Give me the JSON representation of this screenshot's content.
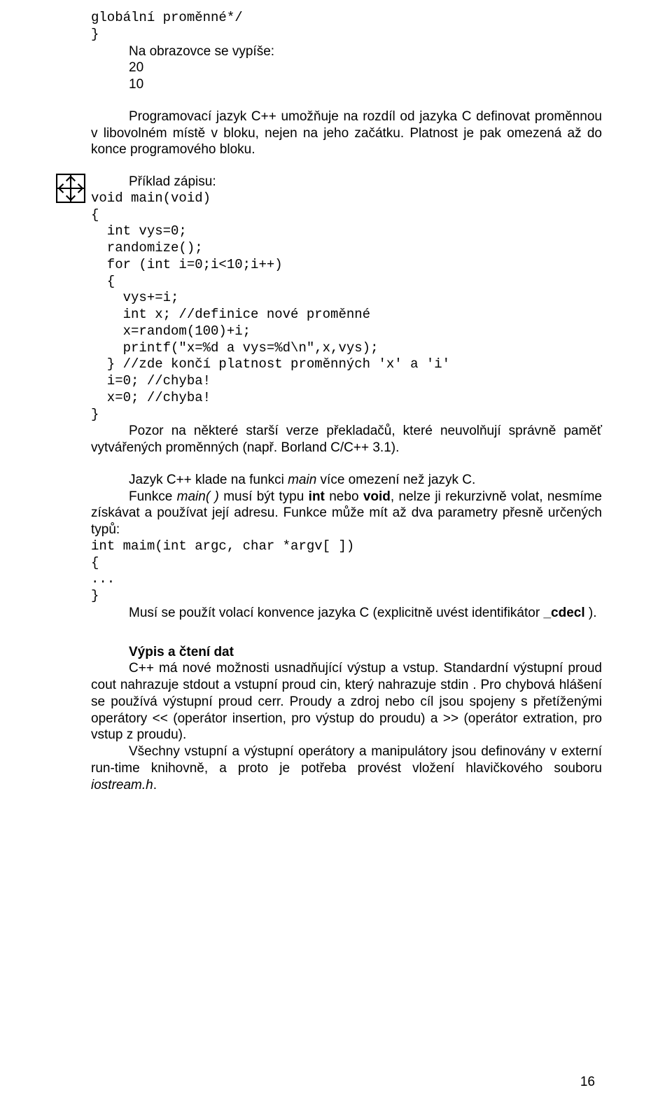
{
  "code_top_1": "globální proměnné*/",
  "code_top_2": "}",
  "out_label": "Na obrazovce se vypíše:",
  "out_1": "20",
  "out_2": "10",
  "para1_a": "Programovací  jazyk C++  umožňuje  na  rozdíl  od  jazyka  C definovat  proměnnou  v libovolném  místě v bloku,  nejen  na  jeho začátku. Platnost je pak omezená až do konce programového bloku.",
  "example": {
    "label": "Příklad zápisu:",
    "l1": "void main(void)",
    "l2": "{",
    "l3": "  int vys=0;",
    "l4": "  randomize();",
    "l5": "  for (int i=0;i<10;i++)",
    "l6": "  {",
    "l7": "    vys+=i;",
    "l8": "    int x; //definice nové proměnné",
    "l9": "    x=random(100)+i;",
    "l10": "    printf(\"x=%d a vys=%d\\n\",x,vys);",
    "l11": "  } //zde končí platnost proměnných 'x' a 'i'",
    "l12": "  i=0; //chyba!",
    "l13": "  x=0; //chyba!",
    "l14": "}"
  },
  "para2": "Pozor  na  některé  starší  verze  překladačů,  které  neuvolňují správně paměť vytvářených proměnných (např. Borland C/C++ 3.1).",
  "para3_a": "Jazyk C++ klade na funkci ",
  "para3_b": "main",
  "para3_c": " více omezení než jazyk C.",
  "para4_a": "Funkce ",
  "para4_b": "main( )",
  "para4_c": " musí být typu ",
  "para4_d": "int",
  "para4_e": " nebo ",
  "para4_f": "void",
  "para4_g": ", nelze ji rekurzivně volat, nesmíme získávat a používat její adresu. Funkce  může  mít až dva parametry přesně určených typů:",
  "proto_1": "int maim(int argc, char *argv[ ])",
  "proto_2": "{",
  "proto_3": "...",
  "proto_4": "}",
  "para5_a": "Musí  se  použít  volací  konvence  jazyka  C  (explicitně  uvést identifikátor ",
  "para5_b": "_cdecl",
  "para5_c": " ).",
  "section_heading": "Výpis a čtení dat",
  "para6_a": "C++ má nové možnosti usnadňující výstup a vstup. Standardní výstupní  proud  cout    nahrazuje  stdout  a  vstupní  proud  cin,  který nahrazuje stdin . Pro chybová hlášení se používá výstupní proud cerr. Proudy  a  zdroj  nebo  cíl  jsou  spojeny  s přetíženými  operátory  << (operátor insertion, pro výstup do proudu) a >> (operátor extration, pro vstup z proudu).",
  "para7_a": "Všechny  vstupní  a  výstupní  operátory  a  manipulátory  jsou definovány v externí run-time knihovně, a proto je potřeba provést vložení hlavičkového souboru ",
  "para7_b": "iostream.h",
  "para7_c": ".",
  "page_number": "16",
  "icon_name": "collapse-icon"
}
